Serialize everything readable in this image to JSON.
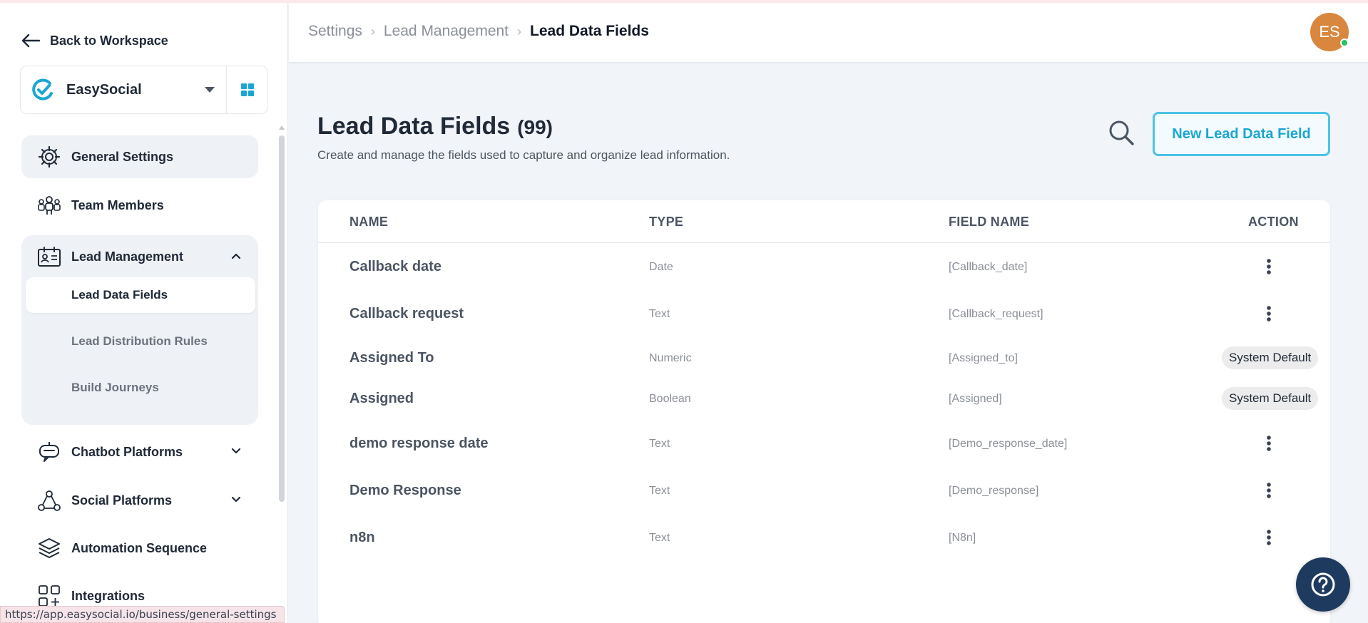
{
  "sidebar": {
    "back_label": "Back to Workspace",
    "workspace": {
      "name": "EasySocial",
      "logo_color": "#1aa6d3"
    },
    "nav": [
      {
        "label": "General Settings",
        "icon": "gear-icon"
      },
      {
        "label": "Team Members",
        "icon": "team-icon"
      },
      {
        "label": "Lead Management",
        "icon": "id-card-icon"
      },
      {
        "label": "Chatbot Platforms",
        "icon": "chatbot-icon"
      },
      {
        "label": "Social Platforms",
        "icon": "social-network-icon"
      },
      {
        "label": "Automation Sequence",
        "icon": "layers-icon"
      },
      {
        "label": "Integrations",
        "icon": "integrations-icon"
      }
    ],
    "sub": [
      {
        "label": "Lead Data Fields"
      },
      {
        "label": "Lead Distribution Rules"
      },
      {
        "label": "Build Journeys"
      }
    ]
  },
  "status_url": "https://app.easysocial.io/business/general-settings",
  "header": {
    "breadcrumbs": [
      "Settings",
      "Lead Management",
      "Lead Data Fields"
    ],
    "avatar_initials": "ES"
  },
  "page": {
    "title": "Lead Data Fields",
    "count": "(99)",
    "description": "Create and manage the fields used to capture and organize lead information.",
    "new_button": "New Lead Data Field"
  },
  "table": {
    "headers": {
      "name": "NAME",
      "type": "TYPE",
      "field": "FIELD NAME",
      "action": "ACTION"
    },
    "rows": [
      {
        "name": "Callback date",
        "type": "Date",
        "field": "[Callback_date]",
        "badge": null
      },
      {
        "name": "Callback request",
        "type": "Text",
        "field": "[Callback_request]",
        "badge": null
      },
      {
        "name": "Assigned To",
        "type": "Numeric",
        "field": "[Assigned_to]",
        "badge": "System Default"
      },
      {
        "name": "Assigned",
        "type": "Boolean",
        "field": "[Assigned]",
        "badge": "System Default"
      },
      {
        "name": "demo response date",
        "type": "Text",
        "field": "[Demo_response_date]",
        "badge": null
      },
      {
        "name": "Demo Response",
        "type": "Text",
        "field": "[Demo_response]",
        "badge": null
      },
      {
        "name": "n8n",
        "type": "Text",
        "field": "[N8n]",
        "badge": null
      }
    ]
  },
  "colors": {
    "accent": "#1aa6d3",
    "help_button": "#1e3a5f",
    "avatar": "#d9873f"
  }
}
